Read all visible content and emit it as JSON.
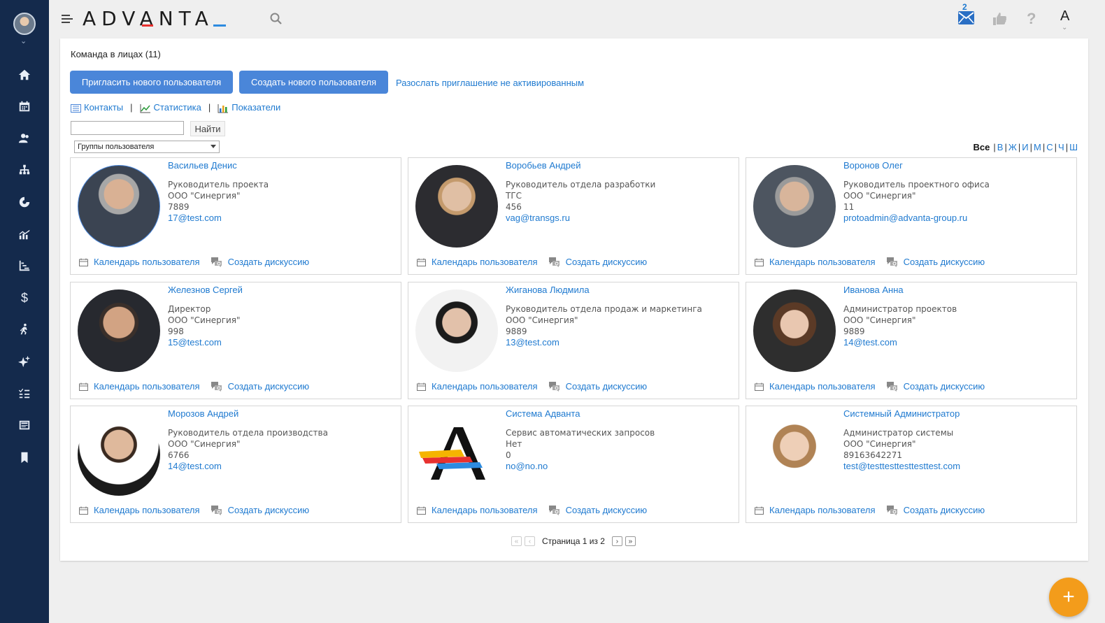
{
  "header": {
    "logo_text": "ADVANTA",
    "mail_count": "2",
    "help_symbol": "?",
    "user_badge": "A"
  },
  "page": {
    "title": "Команда в лицах (11)",
    "invite_button": "Пригласить нового пользователя",
    "create_button": "Создать нового пользователя",
    "resend_link": "Разослать приглашение не активированным",
    "tabs": [
      {
        "label": "Контакты",
        "icon": "list-icon"
      },
      {
        "label": "Статистика",
        "icon": "line-chart-icon"
      },
      {
        "label": "Показатели",
        "icon": "bar-chart-icon"
      }
    ],
    "search_value": "",
    "find_button": "Найти",
    "group_select": "Группы пользователя",
    "alphabet": [
      "Все",
      "В",
      "Ж",
      "И",
      "М",
      "С",
      "Ч",
      "Ш"
    ]
  },
  "cards": [
    {
      "name": "Васильев Денис",
      "position": "Руководитель проекта",
      "company": "ООО \"Синергия\"",
      "phone": "7889",
      "email": "17@test.com"
    },
    {
      "name": "Воробьев Андрей",
      "position": "Руководитель отдела разработки",
      "company": "ТГС",
      "phone": "456",
      "email": "vag@transgs.ru"
    },
    {
      "name": "Воронов Олег",
      "position": "Руководитель проектного офиса",
      "company": "ООО \"Синергия\"",
      "phone": "11",
      "email": "protoadmin@advanta-group.ru"
    },
    {
      "name": "Железнов Сергей",
      "position": "Директор",
      "company": "ООО \"Синергия\"",
      "phone": "998",
      "email": "15@test.com"
    },
    {
      "name": "Жиганова Людмила",
      "position": "Руководитель отдела продаж и маркетинга",
      "company": "ООО \"Синергия\"",
      "phone": "9889",
      "email": "13@test.com"
    },
    {
      "name": "Иванова Анна",
      "position": "Администратор проектов",
      "company": "ООО \"Синергия\"",
      "phone": "9889",
      "email": "14@test.com"
    },
    {
      "name": "Морозов Андрей",
      "position": "Руководитель отдела производства",
      "company": "ООО \"Синергия\"",
      "phone": "6766",
      "email": "14@test.com"
    },
    {
      "name": "Система Адванта",
      "position": "Сервис автоматических запросов",
      "company": "Нет",
      "phone": "0",
      "email": "no@no.no"
    },
    {
      "name": "Системный Администратор",
      "position": "Администратор системы",
      "company": "ООО \"Синергия\"",
      "phone": "89163642271",
      "email": "test@testtesttesttesttest.com"
    }
  ],
  "card_actions": {
    "calendar": "Календарь пользователя",
    "discussion": "Создать дискуссию"
  },
  "pager": {
    "text": "Страница 1 из 2"
  },
  "colors": {
    "sidebar": "#142a4c",
    "accent_blue": "#4a86d9",
    "link": "#1f7ad0",
    "fab": "#f39c1b"
  }
}
